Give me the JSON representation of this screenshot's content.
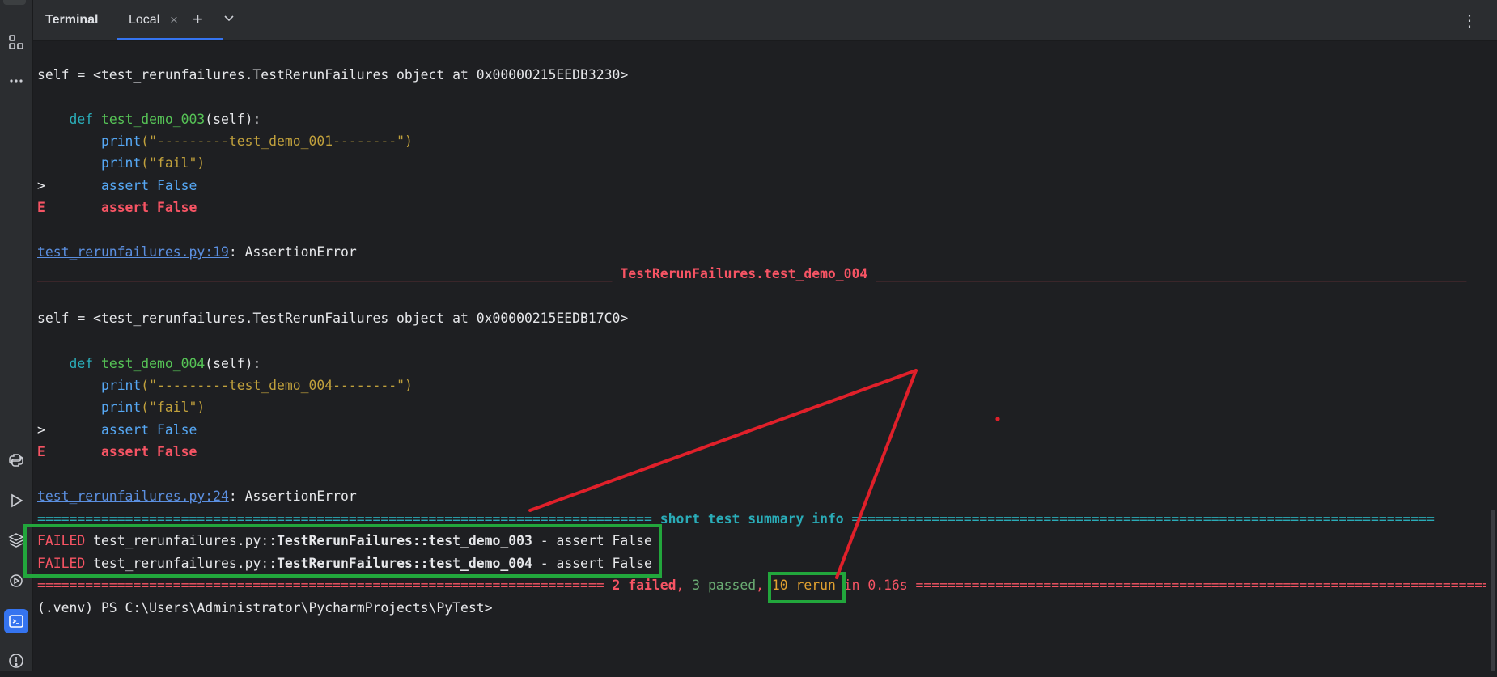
{
  "tool_window": {
    "title": "Terminal",
    "tab_label": "Local",
    "close_glyph": "×",
    "add_glyph": "+",
    "menu_glyph": "⋮"
  },
  "sidebar": {
    "icons": [
      "structure-icon",
      "more-icon",
      "python-console-icon",
      "run-icon",
      "layers-icon",
      "services-icon",
      "terminal-icon",
      "problems-icon"
    ]
  },
  "terminal": {
    "line1": "self = <test_rerunfailures.TestRerunFailures object at 0x00000215EEDB3230>",
    "line2_kw": "def ",
    "line2_fn": "test_demo_003",
    "line2_rest": "(self):",
    "line3_fn": "print",
    "line3_str": "(\"---------test_demo_001--------\")",
    "line4_fn": "print",
    "line4_str": "(\"fail\")",
    "line5_marker": ">",
    "line5_code": "assert False",
    "line6_marker": "E",
    "line6_code": "assert False",
    "line7_link": "test_rerunfailures.py:19",
    "line7_rest": ": AssertionError",
    "line8_left": "________________________________________________________________________",
    "line8_title": " TestRerunFailures.test_demo_004 ",
    "line8_right": "__________________________________________________________________________",
    "line9": "self = <test_rerunfailures.TestRerunFailures object at 0x00000215EEDB17C0>",
    "line10_kw": "def ",
    "line10_fn": "test_demo_004",
    "line10_rest": "(self):",
    "line11_fn": "print",
    "line11_str": "(\"---------test_demo_004--------\")",
    "line12_fn": "print",
    "line12_str": "(\"fail\")",
    "line13_marker": ">",
    "line13_code": "assert False",
    "line14_marker": "E",
    "line14_code": "assert False",
    "line15_link": "test_rerunfailures.py:24",
    "line15_rest": ": AssertionError",
    "line16_left": "=============================================================================",
    "line16_title": " short test summary info ",
    "line16_right": "=========================================================================",
    "fail1_tag": "FAILED",
    "fail1_path": " test_rerunfailures.py::",
    "fail1_cls": "TestRerunFailures::test_demo_003",
    "fail1_msg": " - assert False",
    "fail2_tag": "FAILED",
    "fail2_path": " test_rerunfailures.py::",
    "fail2_cls": "TestRerunFailures::test_demo_004",
    "fail2_msg": " - assert False",
    "sum_left": "======================================================================= ",
    "sum_failed": "2 failed",
    "sum_c1": ", ",
    "sum_passed": "3 passed",
    "sum_c2": ", ",
    "sum_rerun": "10 rerun",
    "sum_time": " in 0.16s ",
    "sum_right": "=========================================================================",
    "prompt": "(.venv) PS C:\\Users\\Administrator\\PycharmProjects\\PyTest>"
  },
  "colors": {
    "background": "#1e1f22",
    "error_red": "#f75464",
    "highlight_box": "#22a63c",
    "annotation_line": "#e0202a"
  }
}
